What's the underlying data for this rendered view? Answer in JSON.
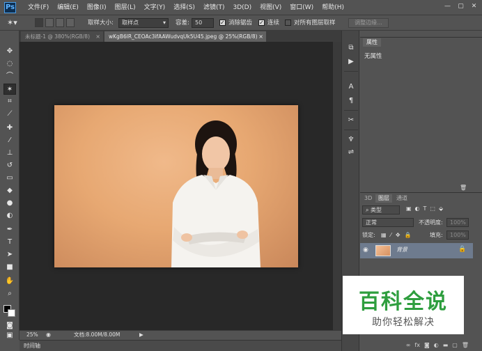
{
  "app": {
    "logo": "Ps"
  },
  "menu": [
    "文件(F)",
    "编辑(E)",
    "图像(I)",
    "图层(L)",
    "文字(Y)",
    "选择(S)",
    "滤镜(T)",
    "3D(D)",
    "视图(V)",
    "窗口(W)",
    "帮助(H)"
  ],
  "window_controls": {
    "minimize": "—",
    "maximize": "▢",
    "close": "✕"
  },
  "options": {
    "sample_size_label": "取样大小:",
    "sample_size_value": "取样点",
    "tolerance_label": "容差:",
    "tolerance_value": "50",
    "antialias_label": "消除锯齿",
    "contiguous_label": "连续",
    "sample_all_label": "对所有图层取样",
    "refine_edge_label": "调整边缘..."
  },
  "tabs": [
    {
      "label": "未标题-1 @ 380%(RGB/8)",
      "close": "×"
    },
    {
      "label": "wKgB6lR_CEOAc3ifAAWudvqUk5U45.jpeg @ 25%(RGB/8)",
      "close": "×"
    }
  ],
  "status": {
    "zoom": "25%",
    "doc_info": "文档:8.00M/8.00M"
  },
  "timeline": {
    "label": "时间轴"
  },
  "properties": {
    "tab": "属性",
    "empty_text": "无属性"
  },
  "layers": {
    "tabs": [
      "3D",
      "图层",
      "通道"
    ],
    "kind_filter": "类型",
    "blend_mode": "正常",
    "opacity_label": "不透明度:",
    "opacity_value": "100%",
    "lock_label": "锁定:",
    "fill_label": "填充:",
    "fill_value": "100%",
    "layer_name": "背景"
  },
  "watermark": {
    "title": "百科全说",
    "subtitle": "助你轻松解决"
  },
  "colors": {
    "foreground": "#000000",
    "background": "#ffffff",
    "canvas_bg": "#282828",
    "ui_bg": "#535353"
  }
}
